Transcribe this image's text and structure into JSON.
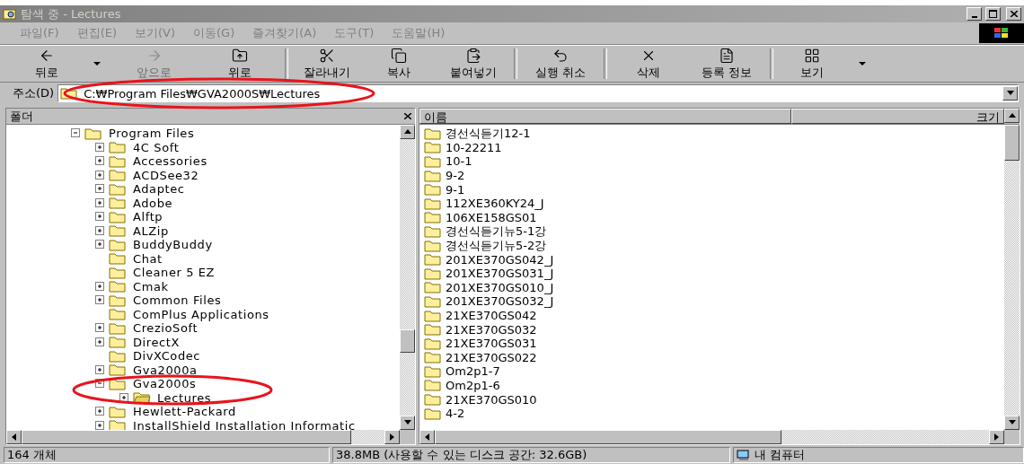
{
  "window": {
    "title": "탐색 중 - Lectures",
    "active": false
  },
  "menu": [
    {
      "label": "파일(F)"
    },
    {
      "label": "편집(E)"
    },
    {
      "label": "보기(V)"
    },
    {
      "label": "이동(G)"
    },
    {
      "label": "즐겨찾기(A)"
    },
    {
      "label": "도구(T)"
    },
    {
      "label": "도움말(H)"
    }
  ],
  "toolbar": [
    {
      "kind": "button",
      "label": "뒤로",
      "disabled": false
    },
    {
      "kind": "caret"
    },
    {
      "kind": "button",
      "label": "앞으로",
      "disabled": true
    },
    {
      "kind": "button",
      "label": "위로",
      "disabled": false
    },
    {
      "kind": "separator"
    },
    {
      "kind": "button",
      "label": "잘라내기",
      "disabled": false
    },
    {
      "kind": "button",
      "label": "복사",
      "disabled": false
    },
    {
      "kind": "button",
      "label": "붙여넣기",
      "disabled": false
    },
    {
      "kind": "separator"
    },
    {
      "kind": "button",
      "label": "실행 취소",
      "disabled": false
    },
    {
      "kind": "separator"
    },
    {
      "kind": "button",
      "label": "삭제",
      "disabled": false
    },
    {
      "kind": "button",
      "label": "등록 정보",
      "disabled": false
    },
    {
      "kind": "separator"
    },
    {
      "kind": "button",
      "label": "보기",
      "disabled": false
    },
    {
      "kind": "caret"
    }
  ],
  "address": {
    "label": "주소(D)",
    "value": "C:₩Program Files₩GVA2000S₩Lectures"
  },
  "folder_pane": {
    "title": "폴더",
    "tree": [
      {
        "label": "Program Files",
        "kind": "branch",
        "expanded": true,
        "selected": false,
        "children": [
          {
            "label": "4C Soft",
            "kind": "branch",
            "expanded": false,
            "selected": false
          },
          {
            "label": "Accessories",
            "kind": "branch",
            "expanded": false,
            "selected": false
          },
          {
            "label": "ACDSee32",
            "kind": "branch",
            "expanded": false,
            "selected": false
          },
          {
            "label": "Adaptec",
            "kind": "branch",
            "expanded": false,
            "selected": false
          },
          {
            "label": "Adobe",
            "kind": "branch",
            "expanded": false,
            "selected": false
          },
          {
            "label": "Alftp",
            "kind": "branch",
            "expanded": false,
            "selected": false
          },
          {
            "label": "ALZip",
            "kind": "branch",
            "expanded": false,
            "selected": false
          },
          {
            "label": "BuddyBuddy",
            "kind": "branch",
            "expanded": false,
            "selected": false
          },
          {
            "label": "Chat",
            "kind": "leaf",
            "selected": false
          },
          {
            "label": "Cleaner 5 EZ",
            "kind": "leaf",
            "selected": false
          },
          {
            "label": "Cmak",
            "kind": "branch",
            "expanded": false,
            "selected": false
          },
          {
            "label": "Common Files",
            "kind": "branch",
            "expanded": false,
            "selected": false
          },
          {
            "label": "ComPlus Applications",
            "kind": "leaf",
            "selected": false
          },
          {
            "label": "CrezioSoft",
            "kind": "branch",
            "expanded": false,
            "selected": false
          },
          {
            "label": "DirectX",
            "kind": "branch",
            "expanded": false,
            "selected": false
          },
          {
            "label": "DivXCodec",
            "kind": "leaf",
            "selected": false
          },
          {
            "label": "Gva2000a",
            "kind": "branch",
            "expanded": false,
            "selected": false
          },
          {
            "label": "Gva2000s",
            "kind": "branch",
            "expanded": true,
            "selected": false,
            "children": [
              {
                "label": "Lectures",
                "kind": "branch",
                "expanded": false,
                "selected": true
              }
            ]
          },
          {
            "label": "Hewlett-Packard",
            "kind": "branch",
            "expanded": false,
            "selected": false
          },
          {
            "label": "InstallShield Installation Informatic",
            "kind": "branch",
            "expanded": false,
            "selected": false
          }
        ]
      }
    ]
  },
  "file_list": {
    "columns": [
      "이름",
      "크기"
    ],
    "items": [
      "경선식듣기12-1",
      "10-22211",
      "10-1",
      "9-2",
      "9-1",
      "112XE360KY24_J",
      "106XE158GS01",
      "경선식듣기뉴5-1강",
      "경선식듣기뉴5-2강",
      "201XE370GS042_J",
      "201XE370GS031_J",
      "201XE370GS010_J",
      "201XE370GS032_J",
      "21XE370GS042",
      "21XE370GS032",
      "21XE370GS031",
      "21XE370GS022",
      "Om2p1-7",
      "Om2p1-6",
      "21XE370GS010",
      "4-2"
    ]
  },
  "status_bar": [
    "164 개체",
    "38.8MB (사용할 수 있는 디스크 공간: 32.6GB)",
    "내 컴퓨터"
  ]
}
